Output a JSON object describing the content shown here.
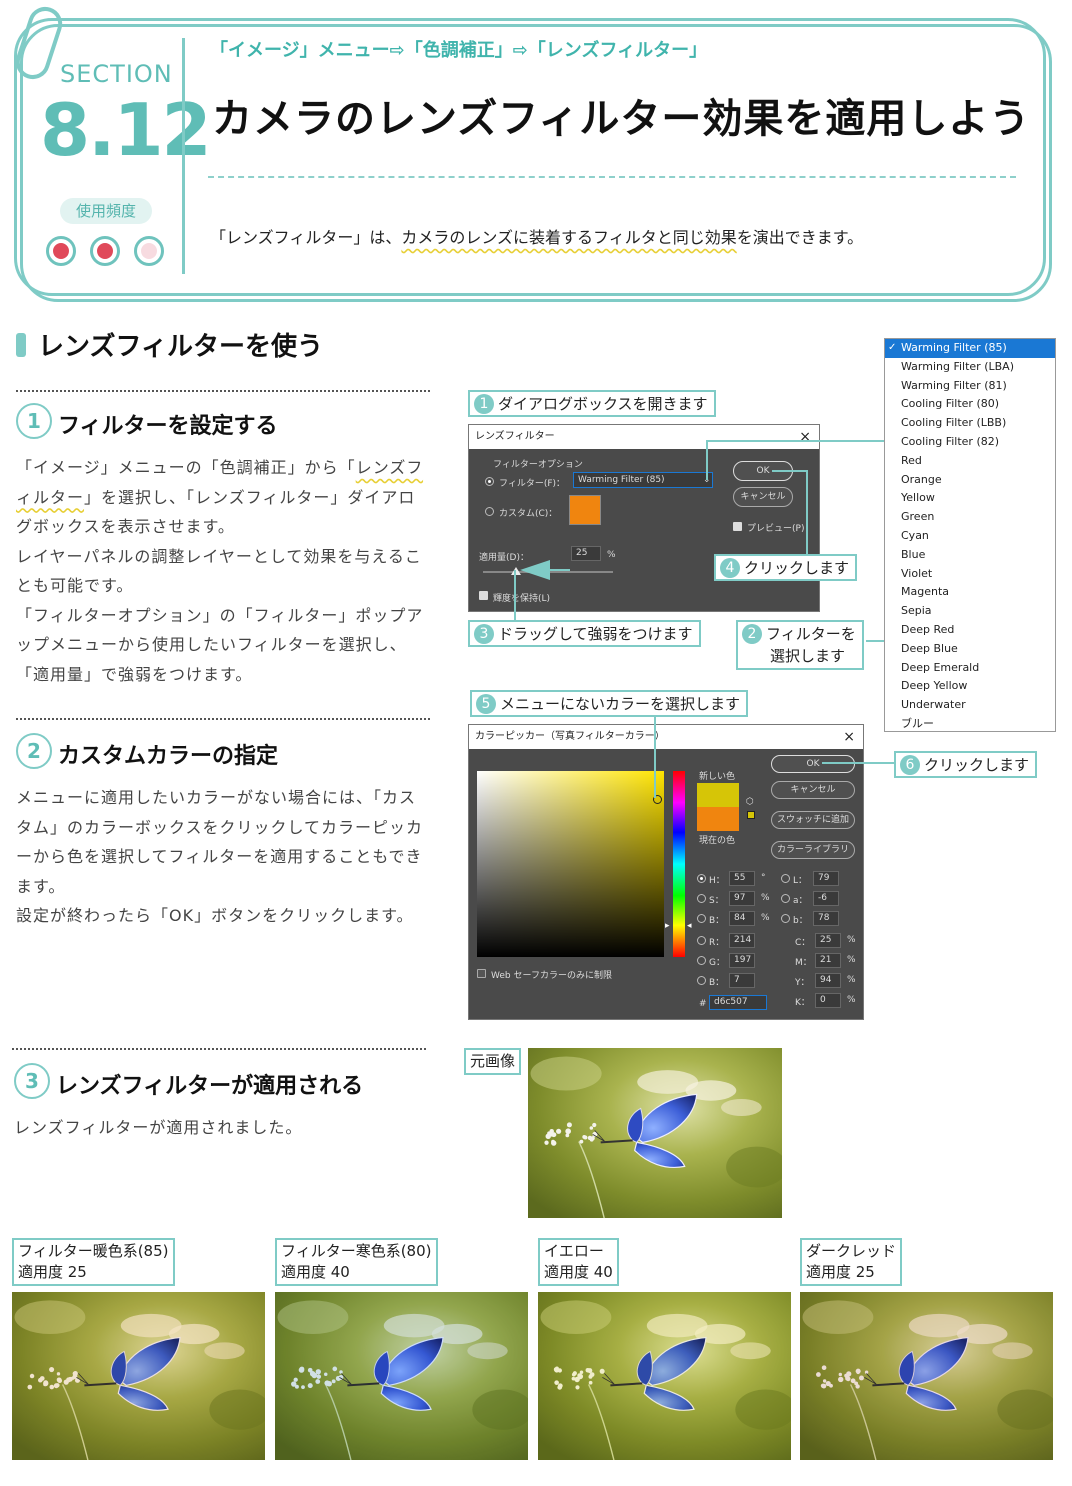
{
  "header": {
    "section_label": "SECTION",
    "section_number": "8.12",
    "frequency_label": "使用頻度",
    "frequency_rating": 2,
    "frequency_max": 3,
    "breadcrumb": "「イメージ」メニュー⇨「色調補正」⇨「レンズフィルター」",
    "title": "カメラのレンズフィルター効果を適用しよう",
    "intro_a": "「レンズフィルター」は、",
    "intro_b": "カメラのレンズに装着するフィルタと同じ効果",
    "intro_c": "を演出できます。"
  },
  "section": {
    "title": "レンズフィルターを使う"
  },
  "steps": [
    {
      "num": "1",
      "title": "フィルターを設定する",
      "p1a": "「イメージ」メニューの「色調補正」から「",
      "p1b": "レンズフ",
      "p1c": "ィルター",
      "p1d": "」を選択し、「レンズフィルター」ダイアロ",
      "p1e": "グボックスを表示させます。",
      "p2": "レイヤーパネルの調整レイヤーとして効果を与えることも可能です。",
      "p3": "「フィルターオプション」の「フィルター」ポップアップメニューから使用したいフィルターを選択し、「適用量」で強弱をつけます。"
    },
    {
      "num": "2",
      "title": "カスタムカラーの指定",
      "p1": "メニューに適用したいカラーがない場合には、「カスタム」のカラーボックスをクリックしてカラーピッカーから色を選択してフィルターを適用することもできます。",
      "p2": "設定が終わったら「OK」ボタンをクリックします。"
    },
    {
      "num": "3",
      "title": "レンズフィルターが適用される",
      "p1": "レンズフィルターが適用されました。"
    }
  ],
  "callouts": {
    "c1": {
      "num": "1",
      "text": "ダイアログボックスを開きます"
    },
    "c2": {
      "num": "2",
      "text": "フィルターを",
      "text2": "選択します"
    },
    "c3": {
      "num": "3",
      "text": "ドラッグして強弱をつけます"
    },
    "c4": {
      "num": "4",
      "text": "クリックします"
    },
    "c5": {
      "num": "5",
      "text": "メニューにないカラーを選択します"
    },
    "c6": {
      "num": "6",
      "text": "クリックします"
    }
  },
  "lens_dialog": {
    "title": "レンズフィルター",
    "close": "×",
    "group_label": "フィルターオプション",
    "filter_label": "フィルター(F)：",
    "filter_value": "Warming Filter (85)",
    "custom_label": "カスタム(C)：",
    "custom_color": "#f0850f",
    "ok": "OK",
    "cancel": "キャンセル",
    "preview": "プレビュー(P)",
    "amount_label": "適用量(D)：",
    "amount_value": "25",
    "amount_unit": "%",
    "preserve": "輝度を保持(L)"
  },
  "filter_menu": {
    "checkmark": "✓",
    "selected_index": 0,
    "items": [
      "Warming Filter (85)",
      "Warming Filter (LBA)",
      "Warming Filter (81)",
      "Cooling Filter (80)",
      "Cooling Filter (LBB)",
      "Cooling Filter (82)",
      "Red",
      "Orange",
      "Yellow",
      "Green",
      "Cyan",
      "Blue",
      "Violet",
      "Magenta",
      "Sepia",
      "Deep Red",
      "Deep Blue",
      "Deep Emerald",
      "Deep Yellow",
      "Underwater",
      "ブルー"
    ]
  },
  "picker_dialog": {
    "title": "カラーピッカー（写真フィルターカラー）",
    "close": "×",
    "new_label": "新しい色",
    "current_label": "現在の色",
    "new_color": "#d6c507",
    "current_color": "#f0850f",
    "ok": "OK",
    "cancel": "キャンセル",
    "add_swatch": "スウォッチに追加",
    "color_library": "カラーライブラリ",
    "web_only": "Web セーフカラーのみに制限",
    "hsb": [
      {
        "l": "H：",
        "v": "55",
        "u": "°"
      },
      {
        "l": "S：",
        "v": "97",
        "u": "%"
      },
      {
        "l": "B：",
        "v": "84",
        "u": "%"
      }
    ],
    "rgb": [
      {
        "l": "R：",
        "v": "214"
      },
      {
        "l": "G：",
        "v": "197"
      },
      {
        "l": "B：",
        "v": "7"
      }
    ],
    "lab": [
      {
        "l": "L：",
        "v": "79"
      },
      {
        "l": "a：",
        "v": "-6"
      },
      {
        "l": "b：",
        "v": "78"
      }
    ],
    "cmyk": [
      {
        "l": "C：",
        "v": "25",
        "u": "%"
      },
      {
        "l": "M：",
        "v": "21",
        "u": "%"
      },
      {
        "l": "Y：",
        "v": "94",
        "u": "%"
      },
      {
        "l": "K：",
        "v": "0",
        "u": "%"
      }
    ],
    "hex_label": "#",
    "hex": "d6c507"
  },
  "photos": {
    "original_label": "元画像",
    "variants": [
      {
        "line1": "フィルター暖色系(85)",
        "line2": "適用度 25",
        "tint": "#f2a23a",
        "tint_opacity": 0.16
      },
      {
        "line1": "フィルター寒色系(80)",
        "line2": "適用度 40",
        "tint": "#5ea7e8",
        "tint_opacity": 0.22
      },
      {
        "line1": "イエロー",
        "line2": "適用度 40",
        "tint": "#e9de2a",
        "tint_opacity": 0.16
      },
      {
        "line1": "ダークレッド",
        "line2": "適用度 25",
        "tint": "#c0483e",
        "tint_opacity": 0.13
      }
    ]
  }
}
